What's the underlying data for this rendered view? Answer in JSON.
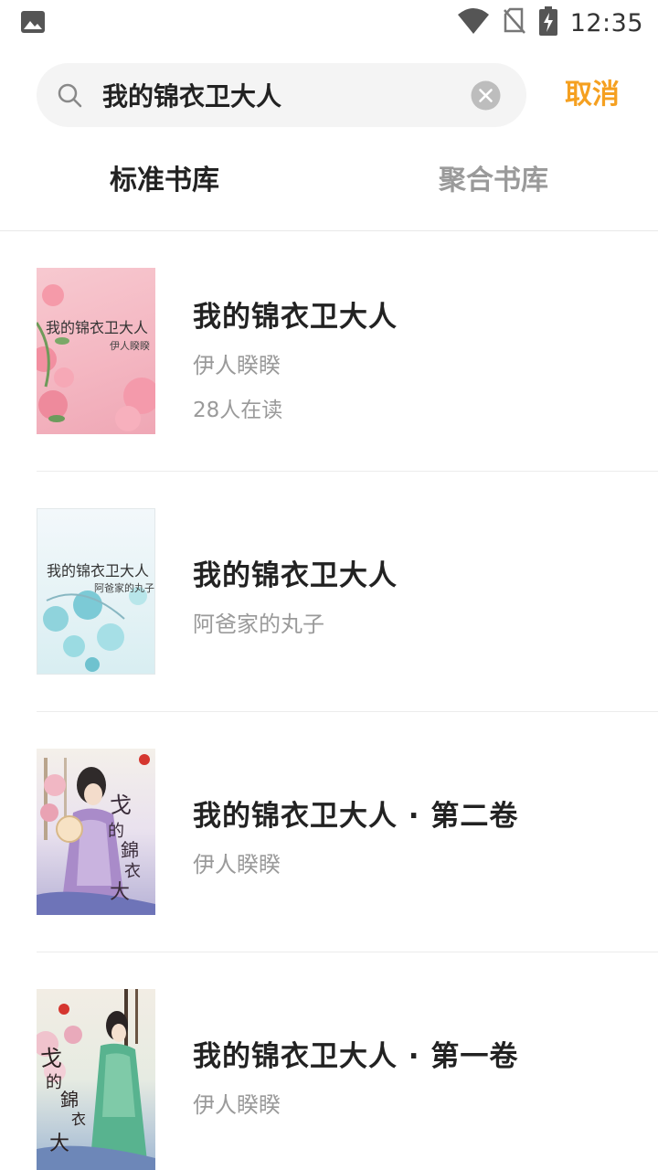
{
  "status_bar": {
    "time": "12:35",
    "icons": [
      "image-notification-icon",
      "wifi-icon",
      "no-sim-icon",
      "battery-charging-icon"
    ]
  },
  "search": {
    "query": "我的锦衣卫大人",
    "cancel_label": "取消",
    "accent_color": "#f5a020"
  },
  "tabs": [
    {
      "label": "标准书库",
      "active": true
    },
    {
      "label": "聚合书库",
      "active": false
    }
  ],
  "books": [
    {
      "title": "我的锦衣卫大人",
      "author": "伊人睽睽",
      "readers": "28人在读",
      "cover_title": "我的锦衣卫大人",
      "cover_author": "伊人睽睽"
    },
    {
      "title": "我的锦衣卫大人",
      "author": "阿爸家的丸子",
      "cover_title": "我的锦衣卫大人",
      "cover_author": "阿爸家的丸子"
    },
    {
      "title": "我的锦衣卫大人 · 第二卷",
      "author": "伊人睽睽"
    },
    {
      "title": "我的锦衣卫大人 · 第一卷",
      "author": "伊人睽睽"
    }
  ]
}
